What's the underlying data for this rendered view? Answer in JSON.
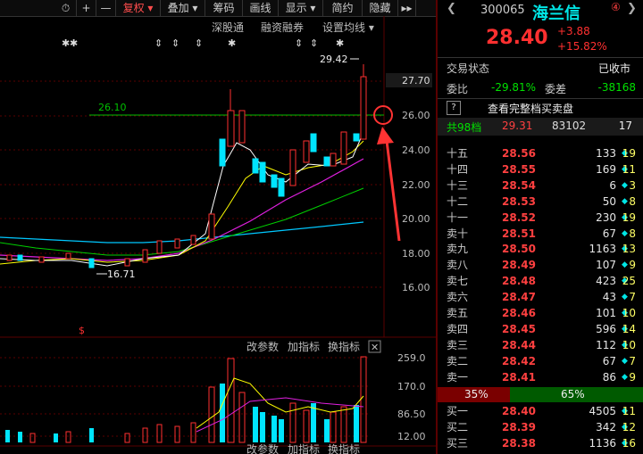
{
  "toolbar": {
    "items": [
      "⏱",
      "+",
      "—",
      "复权 ▾",
      "叠加 ▾",
      "筹码",
      "画线",
      "显示 ▾",
      "简约",
      "隐藏",
      "▸▸"
    ]
  },
  "chart_links": {
    "shenguтong": "深股通",
    "margin": "融资融券",
    "ma_settings": "设置均线 ▾"
  },
  "price_axis": {
    "ticks": [
      "27.70",
      "26.00",
      "24.00",
      "22.00",
      "20.00",
      "18.00",
      "16.00"
    ],
    "current_price_label": "27.70"
  },
  "annotations": {
    "high_label": "29.42",
    "low_label": "16.71",
    "level_line_label": "26.10",
    "dollar_marker": "$"
  },
  "indicator_panel": {
    "links": [
      "改参数",
      "加指标",
      "换指标"
    ],
    "close_icon": "✕",
    "ticks": [
      "259.0",
      "170.0",
      "86.50",
      "12.00"
    ],
    "bottom_links": [
      "改参数",
      "加指标",
      "换指标"
    ]
  },
  "quote": {
    "code": "300065",
    "name": "海兰信",
    "badge": "④",
    "price": "28.40",
    "change": "+3.88",
    "change_pct": "+15.82%",
    "status_label": "交易状态",
    "status_value": "已收市",
    "weibi_label": "委比",
    "weibi_value": "-29.81%",
    "weicha_label": "委差",
    "weicha_value": "-38168",
    "full_book_button": "查看完整档买卖盘",
    "help_icon": "?",
    "total_levels_label": "共98档",
    "total_price": "29.31",
    "total_volume": "83102",
    "total_count": "17"
  },
  "asks": [
    {
      "label": "十五",
      "price": "28.56",
      "volume": "133",
      "count": "19"
    },
    {
      "label": "十四",
      "price": "28.55",
      "volume": "169",
      "count": "11"
    },
    {
      "label": "十三",
      "price": "28.54",
      "volume": "6",
      "count": "3"
    },
    {
      "label": "十二",
      "price": "28.53",
      "volume": "50",
      "count": "8"
    },
    {
      "label": "十一",
      "price": "28.52",
      "volume": "230",
      "count": "19"
    },
    {
      "label": "卖十",
      "price": "28.51",
      "volume": "67",
      "count": "8"
    },
    {
      "label": "卖九",
      "price": "28.50",
      "volume": "1163",
      "count": "13"
    },
    {
      "label": "卖八",
      "price": "28.49",
      "volume": "107",
      "count": "9"
    },
    {
      "label": "卖七",
      "price": "28.48",
      "volume": "423",
      "count": "25"
    },
    {
      "label": "卖六",
      "price": "28.47",
      "volume": "43",
      "count": "7"
    },
    {
      "label": "卖五",
      "price": "28.46",
      "volume": "101",
      "count": "10"
    },
    {
      "label": "卖四",
      "price": "28.45",
      "volume": "596",
      "count": "14"
    },
    {
      "label": "卖三",
      "price": "28.44",
      "volume": "112",
      "count": "10"
    },
    {
      "label": "卖二",
      "price": "28.42",
      "volume": "67",
      "count": "7"
    },
    {
      "label": "卖一",
      "price": "28.41",
      "volume": "86",
      "count": "9"
    }
  ],
  "ratio": {
    "sell_pct": "35%",
    "buy_pct": "65%",
    "sell_fraction": 0.35
  },
  "bids": [
    {
      "label": "买一",
      "price": "28.40",
      "volume": "4505",
      "count": "11"
    },
    {
      "label": "买二",
      "price": "28.39",
      "volume": "342",
      "count": "12"
    },
    {
      "label": "买三",
      "price": "28.38",
      "volume": "1136",
      "count": "16"
    }
  ],
  "colors": {
    "up": "#ff3030",
    "down": "#00e5ff",
    "accent_cyan": "#00e5e5",
    "level_line": "#00c000"
  }
}
